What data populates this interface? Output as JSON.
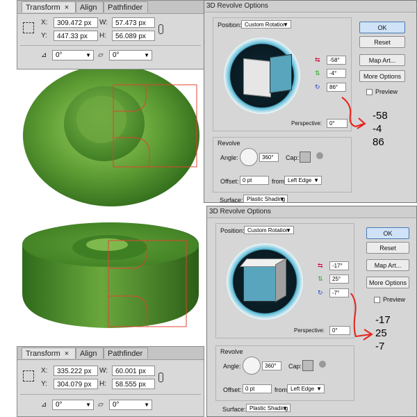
{
  "panel_top": {
    "tabs": [
      "Transform",
      "Align",
      "Pathfinder"
    ],
    "close_glyph": "×",
    "x_label": "X:",
    "x_value": "309.472 px",
    "y_label": "Y:",
    "y_value": "447.33 px",
    "w_label": "W:",
    "w_value": "57.473 px",
    "h_label": "H:",
    "h_value": "56.089 px",
    "rotate_value": "0°",
    "shear_value": "0°"
  },
  "panel_bottom": {
    "tabs": [
      "Transform",
      "Align",
      "Pathfinder"
    ],
    "close_glyph": "×",
    "x_label": "X:",
    "x_value": "335.222 px",
    "y_label": "Y:",
    "y_value": "304.079 px",
    "w_label": "W:",
    "w_value": "60.001 px",
    "h_label": "H:",
    "h_value": "58.555 px",
    "rotate_value": "0°",
    "shear_value": "0°"
  },
  "dialog_top": {
    "title": "3D Revolve Options",
    "position_label": "Position:",
    "position_value": "Custom Rotation",
    "rot_x": "-58°",
    "rot_y": "-4°",
    "rot_z": "86°",
    "perspective_label": "Perspective:",
    "perspective_value": "0°",
    "revolve_label": "Revolve",
    "angle_label": "Angle:",
    "angle_value": "360°",
    "cap_label": "Cap:",
    "offset_label": "Offset:",
    "offset_value": "0 pt",
    "from_label": "from",
    "from_value": "Left Edge",
    "surface_label": "Surface:",
    "surface_value": "Plastic Shading",
    "ok_label": "OK",
    "reset_label": "Reset",
    "map_art_label": "Map Art...",
    "more_options_label": "More Options",
    "preview_label": "Preview"
  },
  "dialog_bottom": {
    "title": "3D Revolve Options",
    "position_label": "Position:",
    "position_value": "Custom Rotation",
    "rot_x": "-17°",
    "rot_y": "25°",
    "rot_z": "-7°",
    "perspective_label": "Perspective:",
    "perspective_value": "0°",
    "revolve_label": "Revolve",
    "angle_label": "Angle:",
    "angle_value": "360°",
    "cap_label": "Cap:",
    "offset_label": "Offset:",
    "offset_value": "0 pt",
    "from_label": "from",
    "from_value": "Left Edge",
    "surface_label": "Surface:",
    "surface_value": "Plastic Shading",
    "ok_label": "OK",
    "reset_label": "Reset",
    "map_art_label": "Map Art...",
    "more_options_label": "More Options",
    "preview_label": "Preview"
  },
  "note_top": [
    "-58",
    "-4",
    "86"
  ],
  "note_bottom": [
    "-17",
    "25",
    "-7"
  ],
  "colors": {
    "shape_green": "#5b9a36",
    "guide_red": "#e0442e",
    "annotation_red": "#e8221c",
    "dialog_bg": "#d6d6d6"
  }
}
